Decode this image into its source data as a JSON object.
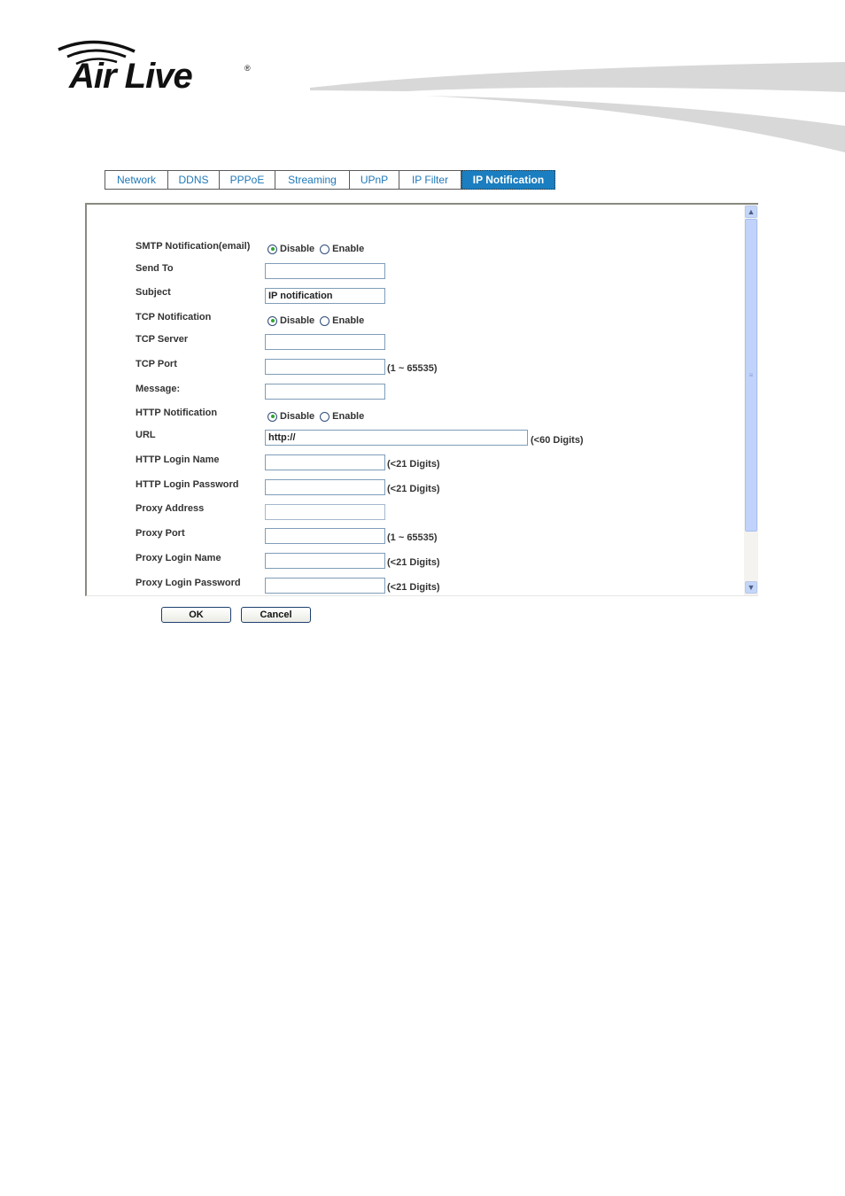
{
  "brand": {
    "name": "Air Live",
    "registered_mark": "®"
  },
  "tabs": [
    {
      "label": "Network",
      "active": false
    },
    {
      "label": "DDNS",
      "active": false
    },
    {
      "label": "PPPoE",
      "active": false
    },
    {
      "label": "Streaming",
      "active": false
    },
    {
      "label": "UPnP",
      "active": false
    },
    {
      "label": "IP Filter",
      "active": false
    },
    {
      "label": "IP Notification",
      "active": true
    }
  ],
  "form": {
    "smtp": {
      "label": "SMTP Notification(email)",
      "options": [
        "Disable",
        "Enable"
      ],
      "selected": "Disable"
    },
    "send_to": {
      "label": "Send To",
      "value": ""
    },
    "subject": {
      "label": "Subject",
      "value": "IP notification"
    },
    "tcp": {
      "label": "TCP Notification",
      "options": [
        "Disable",
        "Enable"
      ],
      "selected": "Disable"
    },
    "tcp_server": {
      "label": "TCP Server",
      "value": ""
    },
    "tcp_port": {
      "label": "TCP Port",
      "value": "",
      "hint": "(1 ~ 65535)"
    },
    "message": {
      "label": "Message:",
      "value": ""
    },
    "http": {
      "label": "HTTP Notification",
      "options": [
        "Disable",
        "Enable"
      ],
      "selected": "Disable"
    },
    "url": {
      "label": "URL",
      "value": "http://",
      "hint": "(<60 Digits)"
    },
    "http_login_name": {
      "label": "HTTP Login Name",
      "value": "",
      "hint": "(<21 Digits)"
    },
    "http_login_password": {
      "label": "HTTP Login Password",
      "value": "",
      "hint": "(<21 Digits)"
    },
    "proxy_address": {
      "label": "Proxy Address",
      "value": ""
    },
    "proxy_port": {
      "label": "Proxy Port",
      "value": "",
      "hint": "(1 ~ 65535)"
    },
    "proxy_login_name": {
      "label": "Proxy Login Name",
      "value": "",
      "hint": "(<21 Digits)"
    },
    "proxy_login_password": {
      "label": "Proxy Login Password",
      "value": "",
      "hint": "(<21 Digits)"
    }
  },
  "scrollbar": {
    "up_icon": "▲",
    "down_icon": "▼",
    "grip_icon": "≡"
  },
  "buttons": {
    "ok": "OK",
    "cancel": "Cancel"
  }
}
